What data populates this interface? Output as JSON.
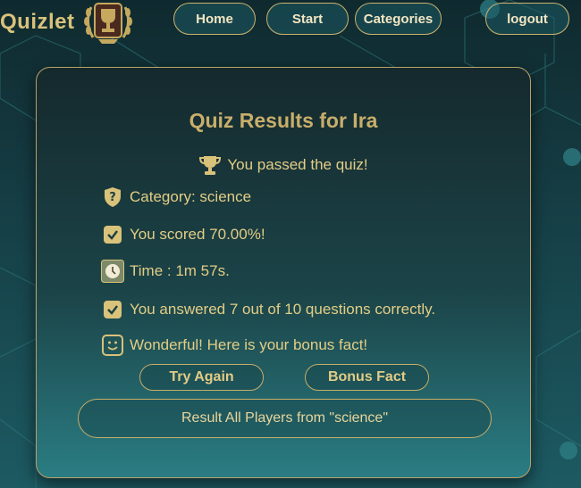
{
  "header": {
    "brand": "Quizlet",
    "nav": {
      "home": "Home",
      "start": "Start",
      "categories": "Categories",
      "logout": "logout"
    }
  },
  "results": {
    "title": "Quiz Results for Ira",
    "passed": "You passed the quiz!",
    "category": "Category: science",
    "score": "You scored 70.00%!",
    "time": "Time : 1m 57s.",
    "answered": "You answered 7 out of 10 questions correctly.",
    "bonus": "Wonderful! Here is your bonus fact!"
  },
  "actions": {
    "try_again": "Try Again",
    "bonus_fact": "Bonus Fact",
    "all_players": "Result All Players from \"science\""
  },
  "icons": {
    "brand_logo": "trophy-wreath-icon",
    "passed": "trophy-icon",
    "category": "question-shield-icon",
    "score": "checkbox-icon",
    "time": "clock-icon",
    "answered": "checkbox-icon",
    "bonus": "smiley-icon"
  },
  "colors": {
    "gold": "#d9c27a",
    "teal_dark": "#0f2a2f",
    "teal_light": "#2a7d83"
  }
}
